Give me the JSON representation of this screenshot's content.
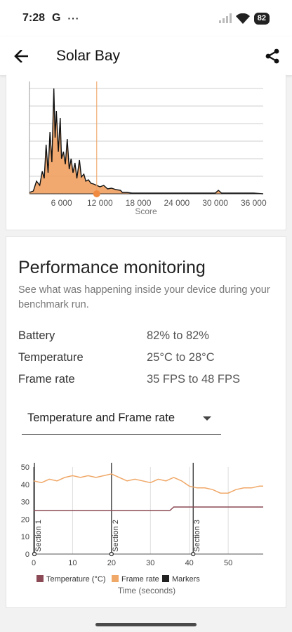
{
  "status_bar": {
    "time": "7:28",
    "notification_letter": "G",
    "more_dots": "···",
    "battery_level": "82"
  },
  "app_bar": {
    "title": "Solar Bay"
  },
  "score_histogram": {
    "type": "area",
    "xlabel": "Score",
    "x_ticks": [
      "6 000",
      "12 000",
      "18 000",
      "24 000",
      "30 000",
      "36 000"
    ],
    "xlim": [
      1000,
      37500
    ],
    "marker_score": 11500,
    "colors": {
      "fill": "#f0a060",
      "line": "#111111",
      "marker": "#f0a060",
      "grid": "#cfcfcf"
    }
  },
  "performance": {
    "title": "Performance monitoring",
    "description": "See what was happening inside your device during your benchmark run.",
    "stats": [
      {
        "label": "Battery",
        "value": "82% to 82%"
      },
      {
        "label": "Temperature",
        "value": "25°C to 28°C"
      },
      {
        "label": "Frame rate",
        "value": "35 FPS to 48 FPS"
      }
    ],
    "dropdown_value": "Temperature and Frame rate"
  },
  "chart_data": {
    "type": "line",
    "xlabel": "Time (seconds)",
    "ylabel": "",
    "xlim": [
      0,
      59
    ],
    "ylim": [
      0,
      50
    ],
    "x_ticks": [
      "0",
      "10",
      "20",
      "30",
      "40",
      "50"
    ],
    "y_ticks": [
      "0",
      "10",
      "20",
      "30",
      "40",
      "50"
    ],
    "series": [
      {
        "name": "Temperature (°C)",
        "color": "#8b4a55",
        "x": [
          0,
          35,
          36,
          59
        ],
        "values": [
          25,
          25,
          27,
          27
        ]
      },
      {
        "name": "Frame rate",
        "color": "#f0a868",
        "x": [
          0,
          2,
          4,
          6,
          8,
          10,
          12,
          14,
          16,
          18,
          20,
          22,
          24,
          26,
          28,
          30,
          32,
          34,
          36,
          38,
          40,
          42,
          44,
          46,
          48,
          50,
          52,
          54,
          56,
          58,
          59
        ],
        "values": [
          42,
          41,
          43,
          42,
          44,
          45,
          44,
          45,
          44,
          45,
          46,
          44,
          42,
          43,
          42,
          41,
          43,
          42,
          44,
          42,
          39,
          38,
          38,
          37,
          35,
          35,
          37,
          38,
          38,
          39,
          39
        ]
      },
      {
        "name": "Markers",
        "color": "#222222",
        "x": [
          0,
          20,
          41
        ],
        "labels": [
          "Section 1",
          "Section 2",
          "Section 3"
        ]
      }
    ],
    "legend": "bottom"
  }
}
